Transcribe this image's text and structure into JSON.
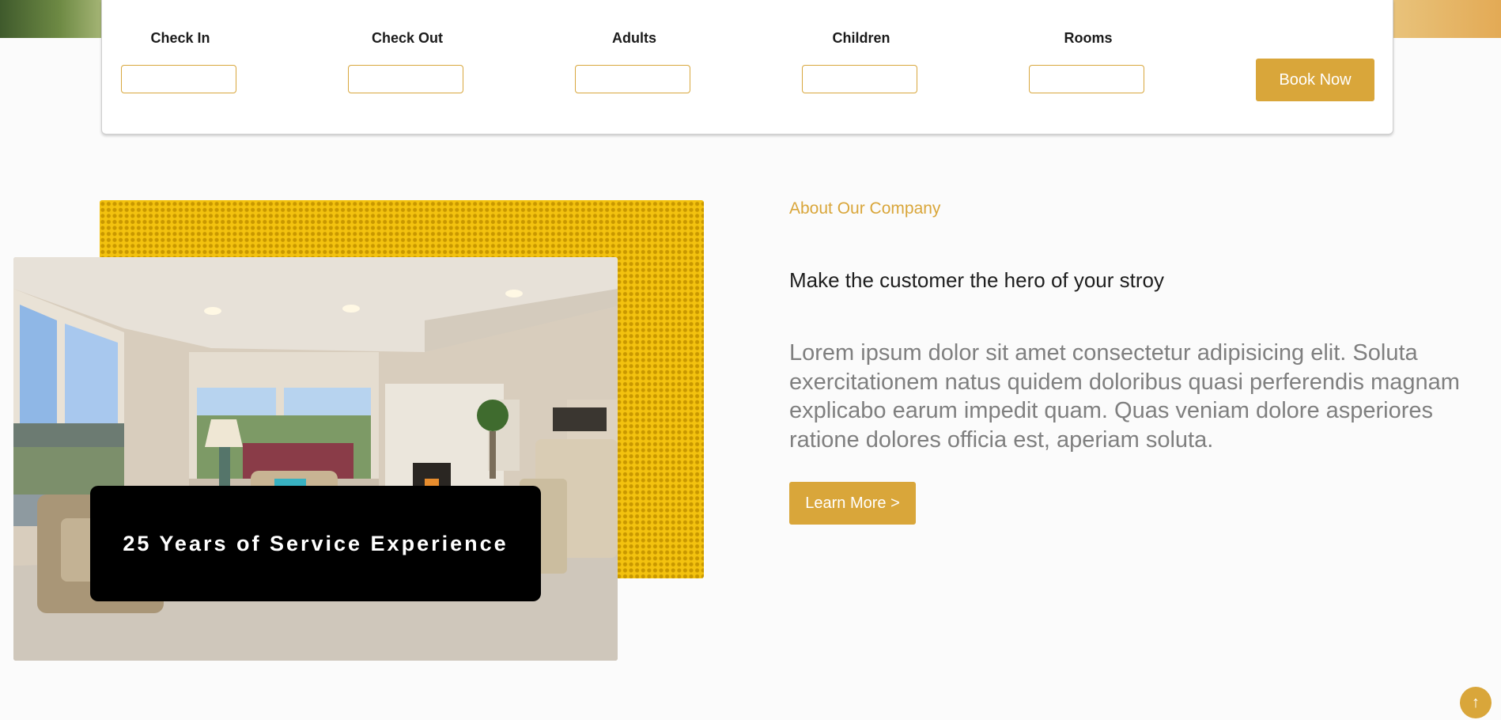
{
  "booking": {
    "fields": [
      {
        "label": "Check In",
        "value": ""
      },
      {
        "label": "Check Out",
        "value": ""
      },
      {
        "label": "Adults",
        "value": ""
      },
      {
        "label": "Children",
        "value": ""
      },
      {
        "label": "Rooms",
        "value": ""
      }
    ],
    "book_label": "Book Now"
  },
  "about": {
    "eyebrow": "About Our Company",
    "heading": "Make the customer the hero of your stroy",
    "body": "Lorem ipsum dolor sit amet consectetur adipisicing elit. Soluta exercitationem natus quidem doloribus quasi perferendis magnam explicabo earum impedit quam. Quas veniam dolore asperiores ratione dolores officia est, aperiam soluta.",
    "learn_more_label": "Learn More >",
    "experience_badge": "25 Years of Service Experience"
  },
  "scroll_top": {
    "icon": "arrow-up-icon",
    "glyph": "↑"
  },
  "colors": {
    "accent": "#d9a63a",
    "pattern": "#f3c20f",
    "badge_bg": "#000000"
  }
}
